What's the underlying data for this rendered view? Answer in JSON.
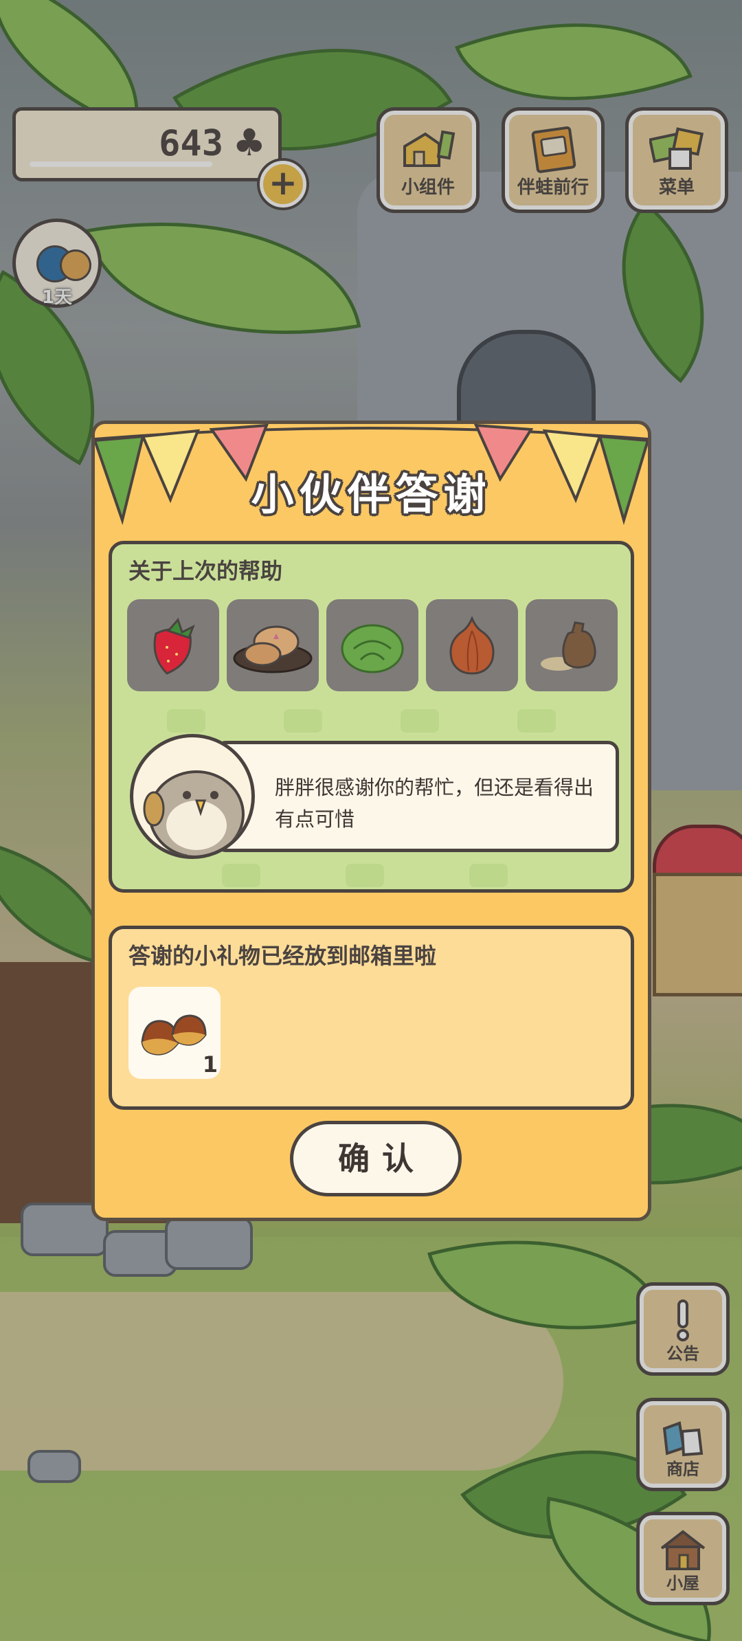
{
  "hud": {
    "clover_count": "643",
    "clover_icon": "clover-icon",
    "plus_label": "+",
    "days_away": "1天"
  },
  "top_menu": [
    {
      "label": "小组件",
      "icon": "widget-icon"
    },
    {
      "label": "伴蛙前行",
      "icon": "journal-icon"
    },
    {
      "label": "菜单",
      "icon": "menu-icon"
    }
  ],
  "side_menu": [
    {
      "label": "公告",
      "icon": "exclamation-icon"
    },
    {
      "label": "商店",
      "icon": "shop-bags-icon"
    },
    {
      "label": "小屋",
      "icon": "house-icon"
    }
  ],
  "modal": {
    "title": "小伙伴答谢",
    "help_heading": "关于上次的帮助",
    "help_items": [
      {
        "name": "strawberry",
        "icon": "strawberry-icon"
      },
      {
        "name": "mooncake",
        "icon": "mooncake-icon"
      },
      {
        "name": "cabbage",
        "icon": "cabbage-icon"
      },
      {
        "name": "onion",
        "icon": "onion-icon"
      },
      {
        "name": "seed-bag",
        "icon": "seed-bag-icon"
      }
    ],
    "message": "胖胖很感谢你的帮忙，但还是看得出有点可惜",
    "gift_heading": "答谢的小礼物已经放到邮箱里啦",
    "gift_item": {
      "name": "chestnut",
      "icon": "chestnut-icon",
      "count": "1"
    },
    "confirm_label": "确认"
  },
  "colors": {
    "modal_bg": "#fbc863",
    "help_panel_bg": "#c9df98",
    "gift_panel_bg": "#fddc98",
    "outline": "#4a4340"
  }
}
